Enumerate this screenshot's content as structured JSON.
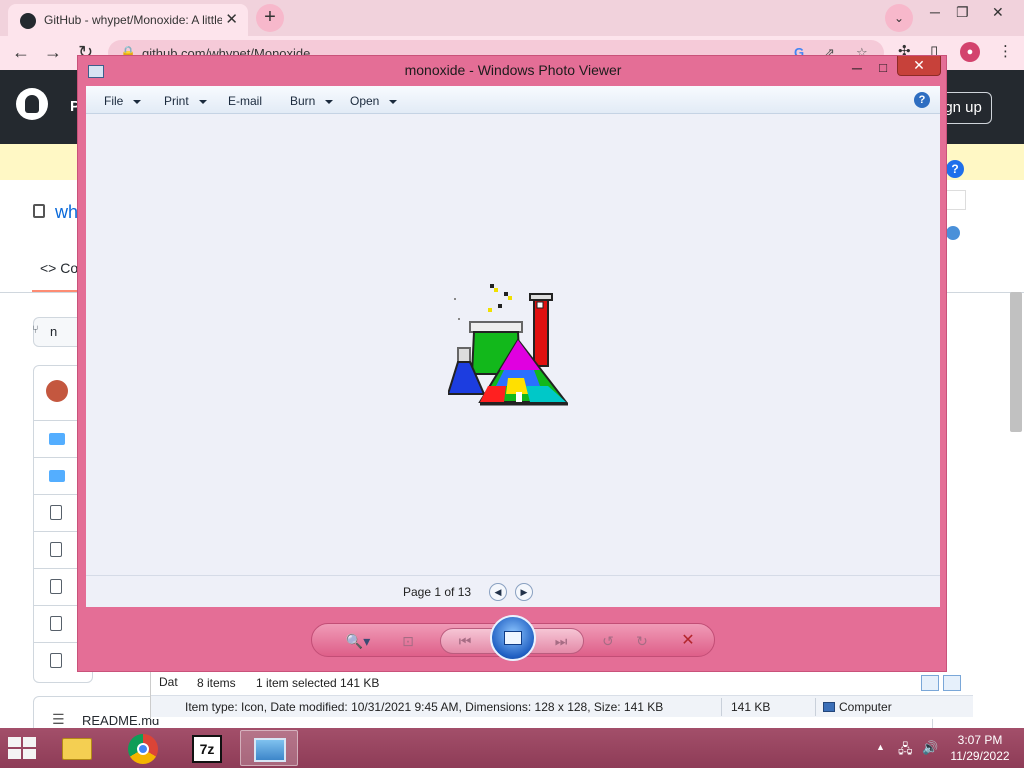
{
  "chrome": {
    "tab_title": "GitHub - whypet/Monoxide: A little",
    "tab_close": "✕",
    "new_tab": "+",
    "tab_search": "⌄",
    "win_minimize": "─",
    "win_restore": "❐",
    "win_close": "✕",
    "back": "←",
    "forward": "→",
    "reload": "↻",
    "url": "github.com/whypet/Monoxide",
    "toolbar_menu": "⋮"
  },
  "github": {
    "header_fragment": "P",
    "signup_fragment": "ign up",
    "help": "?",
    "repo_fragment": "wh",
    "code_tab_fragment": "<> Co",
    "branch_fragment": "n",
    "readme": "README.md",
    "readme_list_icon": "☰"
  },
  "explorer": {
    "date_fragment": "Dat",
    "items_count": "8 items",
    "selection": "1 item selected  141 KB",
    "details": "Item type: Icon, Date modified: 10/31/2021 9:45 AM, Dimensions: 128 x 128, Size: 141 KB",
    "size": "141 KB",
    "location": "Computer"
  },
  "photo_viewer": {
    "title": "monoxide - Windows Photo Viewer",
    "minimize": "─",
    "maximize": "□",
    "close": "✕",
    "menu": {
      "file": "File",
      "print": "Print",
      "email": "E-mail",
      "burn": "Burn",
      "open": "Open"
    },
    "help": "?",
    "page_status": "Page 1 of 13",
    "prev_page": "◀",
    "next_page": "▶",
    "controls": {
      "zoom": "🔍▾",
      "actual_size": "⊡",
      "previous": "⏮",
      "next": "⏭",
      "rotate_ccw": "↺",
      "rotate_cw": "↻",
      "delete": "✕"
    },
    "image_icon": "flask-chemistry-icon"
  },
  "taskbar": {
    "seven_zip": "7z",
    "tray_caret": "▲",
    "network": "🖧",
    "volume": "🔊",
    "time": "3:07 PM",
    "date": "11/29/2022"
  }
}
